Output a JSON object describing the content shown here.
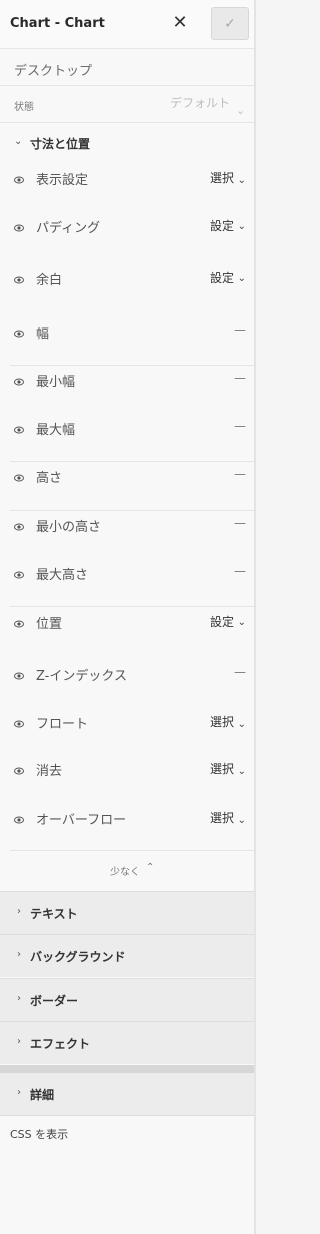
{
  "header": {
    "title": "Chart - Chart",
    "close_symbol": "✕",
    "check_symbol": "✓"
  },
  "device": {
    "label": "デスクトップ"
  },
  "state": {
    "label": "状態",
    "value": "デフォルト"
  },
  "section": {
    "label": "寸法と位置"
  },
  "rows": [
    {
      "label": "表示設定",
      "value": "選択"
    },
    {
      "label": "パディング",
      "value": "設定"
    },
    {
      "label": "余白",
      "value": "設定"
    },
    {
      "label": "幅",
      "value": "—"
    },
    {
      "label": "最小幅",
      "value": "—"
    },
    {
      "label": "最大幅",
      "value": "—"
    },
    {
      "label": "高さ",
      "value": "—"
    },
    {
      "label": "最小の高さ",
      "value": "—"
    },
    {
      "label": "最大高さ",
      "value": "—"
    },
    {
      "label": "位置",
      "value": "設定"
    },
    {
      "label": "Z-インデックス",
      "value": "—"
    },
    {
      "label": "フロート",
      "value": "選択"
    },
    {
      "label": "消去",
      "value": "選択"
    },
    {
      "label": "オーバーフロー",
      "value": "選択"
    }
  ],
  "less_label": "少なく",
  "groups": [
    {
      "label": "テキスト"
    },
    {
      "label": "バックグラウンド"
    },
    {
      "label": "ボーダー"
    },
    {
      "label": "エフェクト"
    }
  ],
  "detail": {
    "label": "詳細"
  },
  "css_label": "CSS を表示"
}
